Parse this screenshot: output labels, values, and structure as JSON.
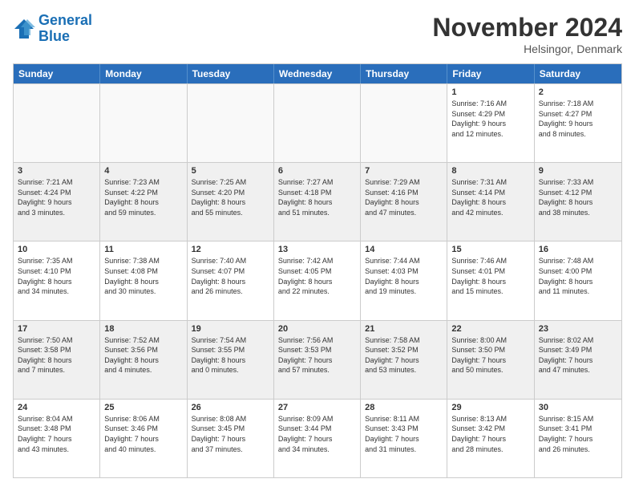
{
  "header": {
    "logo_line1": "General",
    "logo_line2": "Blue",
    "month_title": "November 2024",
    "location": "Helsingor, Denmark"
  },
  "weekdays": [
    "Sunday",
    "Monday",
    "Tuesday",
    "Wednesday",
    "Thursday",
    "Friday",
    "Saturday"
  ],
  "rows": [
    [
      {
        "day": "",
        "info": "",
        "empty": true
      },
      {
        "day": "",
        "info": "",
        "empty": true
      },
      {
        "day": "",
        "info": "",
        "empty": true
      },
      {
        "day": "",
        "info": "",
        "empty": true
      },
      {
        "day": "",
        "info": "",
        "empty": true
      },
      {
        "day": "1",
        "info": "Sunrise: 7:16 AM\nSunset: 4:29 PM\nDaylight: 9 hours\nand 12 minutes.",
        "empty": false
      },
      {
        "day": "2",
        "info": "Sunrise: 7:18 AM\nSunset: 4:27 PM\nDaylight: 9 hours\nand 8 minutes.",
        "empty": false
      }
    ],
    [
      {
        "day": "3",
        "info": "Sunrise: 7:21 AM\nSunset: 4:24 PM\nDaylight: 9 hours\nand 3 minutes.",
        "empty": false
      },
      {
        "day": "4",
        "info": "Sunrise: 7:23 AM\nSunset: 4:22 PM\nDaylight: 8 hours\nand 59 minutes.",
        "empty": false
      },
      {
        "day": "5",
        "info": "Sunrise: 7:25 AM\nSunset: 4:20 PM\nDaylight: 8 hours\nand 55 minutes.",
        "empty": false
      },
      {
        "day": "6",
        "info": "Sunrise: 7:27 AM\nSunset: 4:18 PM\nDaylight: 8 hours\nand 51 minutes.",
        "empty": false
      },
      {
        "day": "7",
        "info": "Sunrise: 7:29 AM\nSunset: 4:16 PM\nDaylight: 8 hours\nand 47 minutes.",
        "empty": false
      },
      {
        "day": "8",
        "info": "Sunrise: 7:31 AM\nSunset: 4:14 PM\nDaylight: 8 hours\nand 42 minutes.",
        "empty": false
      },
      {
        "day": "9",
        "info": "Sunrise: 7:33 AM\nSunset: 4:12 PM\nDaylight: 8 hours\nand 38 minutes.",
        "empty": false
      }
    ],
    [
      {
        "day": "10",
        "info": "Sunrise: 7:35 AM\nSunset: 4:10 PM\nDaylight: 8 hours\nand 34 minutes.",
        "empty": false
      },
      {
        "day": "11",
        "info": "Sunrise: 7:38 AM\nSunset: 4:08 PM\nDaylight: 8 hours\nand 30 minutes.",
        "empty": false
      },
      {
        "day": "12",
        "info": "Sunrise: 7:40 AM\nSunset: 4:07 PM\nDaylight: 8 hours\nand 26 minutes.",
        "empty": false
      },
      {
        "day": "13",
        "info": "Sunrise: 7:42 AM\nSunset: 4:05 PM\nDaylight: 8 hours\nand 22 minutes.",
        "empty": false
      },
      {
        "day": "14",
        "info": "Sunrise: 7:44 AM\nSunset: 4:03 PM\nDaylight: 8 hours\nand 19 minutes.",
        "empty": false
      },
      {
        "day": "15",
        "info": "Sunrise: 7:46 AM\nSunset: 4:01 PM\nDaylight: 8 hours\nand 15 minutes.",
        "empty": false
      },
      {
        "day": "16",
        "info": "Sunrise: 7:48 AM\nSunset: 4:00 PM\nDaylight: 8 hours\nand 11 minutes.",
        "empty": false
      }
    ],
    [
      {
        "day": "17",
        "info": "Sunrise: 7:50 AM\nSunset: 3:58 PM\nDaylight: 8 hours\nand 7 minutes.",
        "empty": false
      },
      {
        "day": "18",
        "info": "Sunrise: 7:52 AM\nSunset: 3:56 PM\nDaylight: 8 hours\nand 4 minutes.",
        "empty": false
      },
      {
        "day": "19",
        "info": "Sunrise: 7:54 AM\nSunset: 3:55 PM\nDaylight: 8 hours\nand 0 minutes.",
        "empty": false
      },
      {
        "day": "20",
        "info": "Sunrise: 7:56 AM\nSunset: 3:53 PM\nDaylight: 7 hours\nand 57 minutes.",
        "empty": false
      },
      {
        "day": "21",
        "info": "Sunrise: 7:58 AM\nSunset: 3:52 PM\nDaylight: 7 hours\nand 53 minutes.",
        "empty": false
      },
      {
        "day": "22",
        "info": "Sunrise: 8:00 AM\nSunset: 3:50 PM\nDaylight: 7 hours\nand 50 minutes.",
        "empty": false
      },
      {
        "day": "23",
        "info": "Sunrise: 8:02 AM\nSunset: 3:49 PM\nDaylight: 7 hours\nand 47 minutes.",
        "empty": false
      }
    ],
    [
      {
        "day": "24",
        "info": "Sunrise: 8:04 AM\nSunset: 3:48 PM\nDaylight: 7 hours\nand 43 minutes.",
        "empty": false
      },
      {
        "day": "25",
        "info": "Sunrise: 8:06 AM\nSunset: 3:46 PM\nDaylight: 7 hours\nand 40 minutes.",
        "empty": false
      },
      {
        "day": "26",
        "info": "Sunrise: 8:08 AM\nSunset: 3:45 PM\nDaylight: 7 hours\nand 37 minutes.",
        "empty": false
      },
      {
        "day": "27",
        "info": "Sunrise: 8:09 AM\nSunset: 3:44 PM\nDaylight: 7 hours\nand 34 minutes.",
        "empty": false
      },
      {
        "day": "28",
        "info": "Sunrise: 8:11 AM\nSunset: 3:43 PM\nDaylight: 7 hours\nand 31 minutes.",
        "empty": false
      },
      {
        "day": "29",
        "info": "Sunrise: 8:13 AM\nSunset: 3:42 PM\nDaylight: 7 hours\nand 28 minutes.",
        "empty": false
      },
      {
        "day": "30",
        "info": "Sunrise: 8:15 AM\nSunset: 3:41 PM\nDaylight: 7 hours\nand 26 minutes.",
        "empty": false
      }
    ]
  ]
}
